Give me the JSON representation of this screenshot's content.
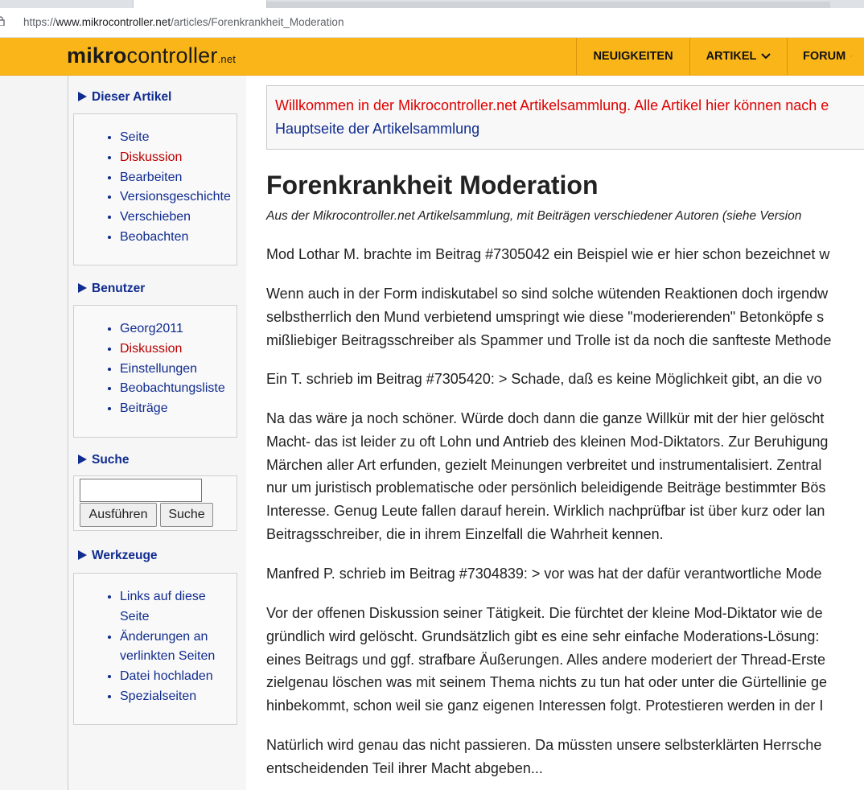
{
  "browser": {
    "url_prefix": "https://",
    "url_host": "www.mikrocontroller.net",
    "url_path": "/articles/Forenkrankheit_Moderation"
  },
  "header": {
    "logo_bold": "mikro",
    "logo_rest": "controller",
    "logo_suffix": ".net",
    "nav": [
      "NEUIGKEITEN",
      "ARTIKEL",
      "FORUM"
    ],
    "accent_color": "#fab619"
  },
  "sidebar": {
    "article_title": "Dieser Artikel",
    "article_items": [
      "Seite",
      "Diskussion",
      "Bearbeiten",
      "Versionsgeschichte",
      "Verschieben",
      "Beobachten"
    ],
    "user_title": "Benutzer",
    "user_items": [
      "Georg2011",
      "Diskussion",
      "Einstellungen",
      "Beobachtungsliste",
      "Beiträge"
    ],
    "search_title": "Suche",
    "search_go": "Ausführen",
    "search_btn": "Suche",
    "tools_title": "Werkzeuge",
    "tools_items": [
      "Links auf diese",
      "Seite",
      "Änderungen an",
      "verlinkten Seiten",
      "Datei hochladen",
      "Spezialseiten"
    ]
  },
  "content": {
    "notice_text": "Willkommen in der Mikrocontroller.net Artikelsammlung. Alle Artikel hier können nach e",
    "notice_link": "Hauptseite der Artikelsammlung",
    "title": "Forenkrankheit Moderation",
    "subtitle": "Aus der Mikrocontroller.net Artikelsammlung, mit Beiträgen verschiedener Autoren (siehe Version",
    "p1": [
      "Mod Lothar M. brachte im Beitrag #7305042 ein Beispiel wie er hier schon bezeichnet w"
    ],
    "p2": [
      "Wenn auch in der Form indiskutabel so sind solche wütenden Reaktionen doch irgendw",
      "selbstherrlich den Mund verbietend umspringt wie diese \"moderierenden\" Betonköpfe s",
      "mißliebiger Beitragsschreiber als Spammer und Trolle ist da noch die sanfteste Methode"
    ],
    "p3": [
      "Ein T. schrieb im Beitrag #7305420: > Schade, daß es keine Möglichkeit gibt, an die vo"
    ],
    "p4": [
      "Na das wäre ja noch schöner. Würde doch dann die ganze Willkür mit der hier gelöscht",
      "Macht- das ist leider zu oft Lohn und Antrieb des kleinen Mod-Diktators. Zur Beruhigung",
      "Märchen aller Art erfunden, gezielt Meinungen verbreitet und instrumentalisiert. Zentral",
      "nur um juristisch problematische oder persönlich beleidigende Beiträge bestimmter Bös",
      "Interesse. Genug Leute fallen darauf herein. Wirklich nachprüfbar ist über kurz oder lan",
      "Beitragsschreiber, die in ihrem Einzelfall die Wahrheit kennen."
    ],
    "p5": [
      "Manfred P. schrieb im Beitrag #7304839: > vor was hat der dafür verantwortliche Mode"
    ],
    "p6": [
      "Vor der offenen Diskussion seiner Tätigkeit. Die fürchtet der kleine Mod-Diktator wie de",
      "gründlich wird gelöscht. Grundsätzlich gibt es eine sehr einfache Moderations-Lösung:",
      "eines Beitrags und ggf. strafbare Äußerungen. Alles andere moderiert der Thread-Erste",
      "zielgenau löschen was mit seinem Thema nichts zu tun hat oder unter die Gürtellinie ge",
      "hinbekommt, schon weil sie ganz eigenen Interessen folgt. Protestieren werden in der I"
    ],
    "p7": [
      "Natürlich wird genau das nicht passieren. Da müssten unsere selbsterklärten Herrsche",
      "entscheidenden Teil ihrer Macht abgeben..."
    ]
  }
}
